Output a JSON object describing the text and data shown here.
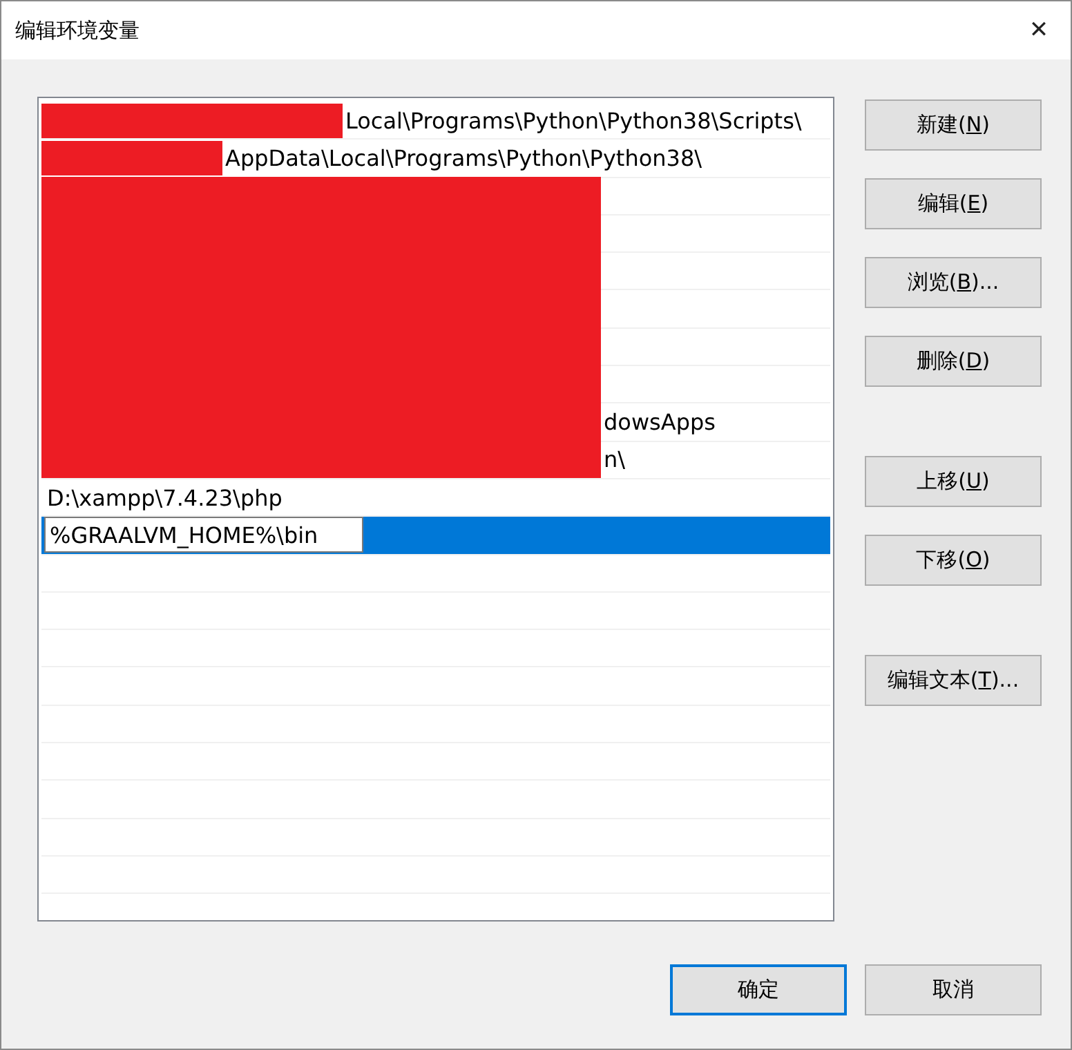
{
  "window": {
    "title": "编辑环境变量",
    "close": "✕"
  },
  "rows": [
    {
      "redacted": true,
      "text": "Local\\Programs\\Python\\Python38\\Scripts\\",
      "selected": false
    },
    {
      "redacted": true,
      "text": "AppData\\Local\\Programs\\Python\\Python38\\",
      "selected": false
    },
    {
      "redacted": true,
      "selected": false
    },
    {
      "redacted": true,
      "selected": false
    },
    {
      "redacted": true,
      "selected": false
    },
    {
      "redacted": true,
      "selected": false
    },
    {
      "redacted": true,
      "selected": false
    },
    {
      "redacted": true,
      "selected": false
    },
    {
      "redacted": true,
      "text": "dowsApps",
      "selected": false
    },
    {
      "redacted": true,
      "text": "n\\",
      "selected": false
    },
    {
      "redacted": false,
      "text": "D:\\xampp\\7.4.23\\php",
      "selected": false
    },
    {
      "redacted": false,
      "text": "%GRAALVM_HOME%\\bin",
      "selected": true,
      "editing": true
    }
  ],
  "button_groups": [
    [
      {
        "before": "新建(",
        "mnemonic": "N",
        "after": ")"
      },
      {
        "before": "编辑(",
        "mnemonic": "E",
        "after": ")"
      },
      {
        "before": "浏览(",
        "mnemonic": "B",
        "after": ")..."
      },
      {
        "before": "删除(",
        "mnemonic": "D",
        "after": ")"
      }
    ],
    [
      {
        "before": "上移(",
        "mnemonic": "U",
        "after": ")"
      },
      {
        "before": "下移(",
        "mnemonic": "O",
        "after": ")"
      }
    ],
    [
      {
        "before": "编辑文本(",
        "mnemonic": "T",
        "after": ")..."
      }
    ]
  ],
  "footer_buttons": [
    {
      "label": "确定",
      "default": true
    },
    {
      "label": "取消",
      "default": false
    }
  ]
}
